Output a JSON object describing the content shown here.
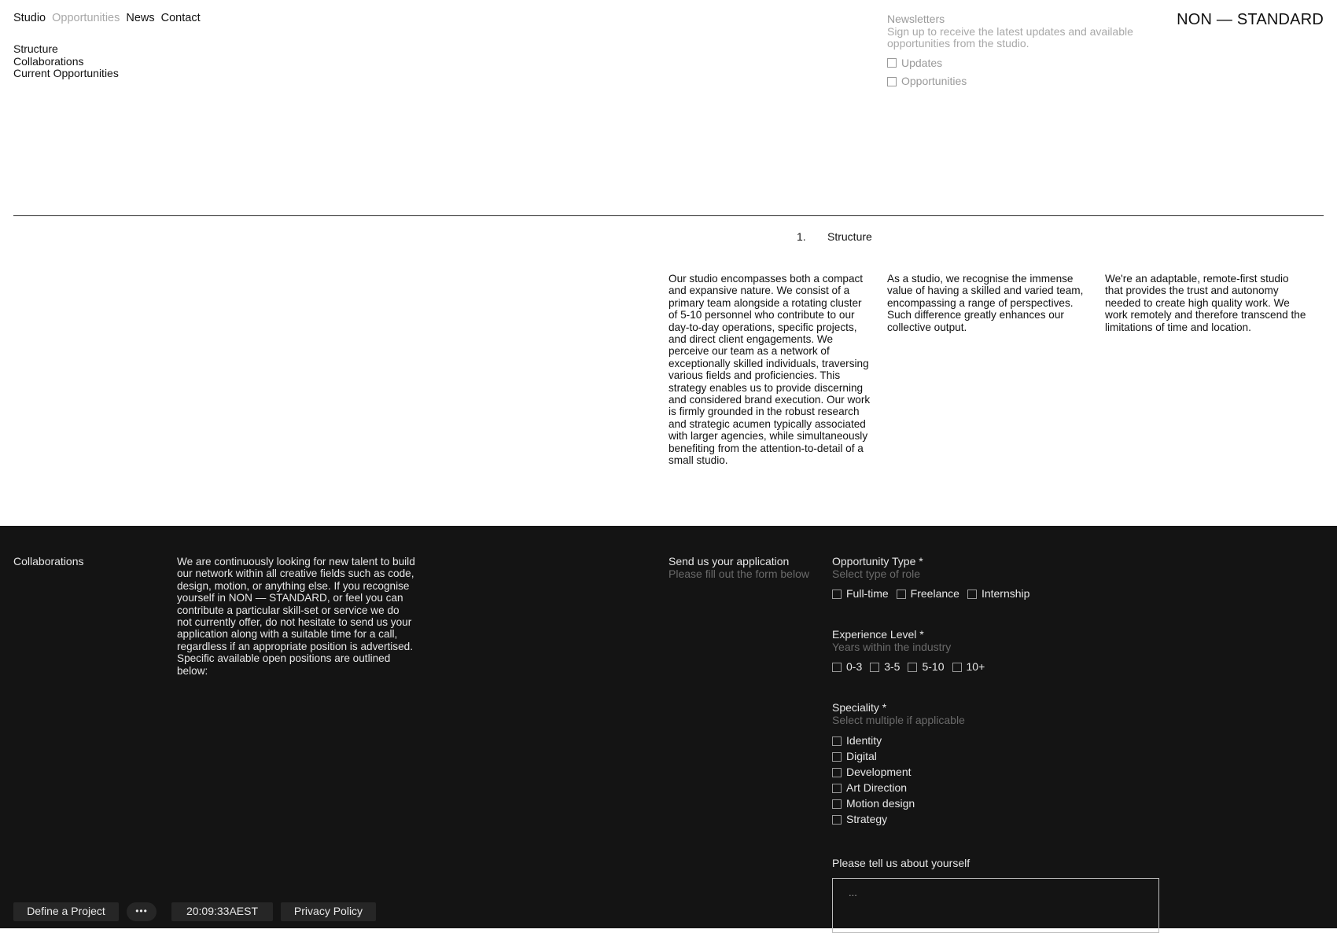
{
  "nav": {
    "items": [
      {
        "label": "Studio",
        "active": false
      },
      {
        "label": "Opportunities",
        "active": true
      },
      {
        "label": "News",
        "active": false
      },
      {
        "label": "Contact",
        "active": false
      }
    ],
    "sub_items": [
      "Structure",
      "Collaborations",
      "Current Opportunities"
    ]
  },
  "newsletter": {
    "title": "Newsletters",
    "description": "Sign up to receive the latest updates and available opportunities from the studio.",
    "options": [
      "Updates",
      "Opportunities"
    ]
  },
  "brand": "NON — STANDARD",
  "section": {
    "number": "1.",
    "title": "Structure",
    "columns": [
      "Our studio encompasses both a compact and expansive nature. We consist of a primary team alongside a rotating cluster of 5-10 personnel who contribute to our day-to-day operations, specific projects, and direct client engagements. We perceive our team as a network of exceptionally skilled individuals, traversing various fields and proficiencies. This strategy enables us to provide discerning and considered brand execution. Our work is firmly grounded in the robust research and strategic acumen typically associated with larger agencies, while simultaneously benefiting from the attention-to-detail of a small studio.",
      "As a studio, we recognise the immense value of having a skilled and varied team, encompassing a range of perspectives. Such difference greatly enhances our collective output.",
      "We're an adaptable, remote-first studio that provides the trust and autonomy needed to create high quality work. We work remotely and therefore transcend the limitations of time and location."
    ]
  },
  "collaborations": {
    "title": "Collaborations",
    "text": "We are continuously looking for new talent to build our network within all creative fields such as code, design, motion, or anything else. If you recognise yourself in NON — STANDARD, or feel you can contribute a particular skill-set or service we do not currently offer, do not hesitate to send us your application along with a suitable time for a call, regardless if an appropriate position is advertised. Specific available open positions are outlined below:"
  },
  "application": {
    "title": "Send us your application",
    "subtitle": "Please fill out the form below"
  },
  "form": {
    "opportunity": {
      "label": "Opportunity Type *",
      "hint": "Select type of role",
      "options": [
        "Full-time",
        "Freelance",
        "Internship"
      ]
    },
    "experience": {
      "label": "Experience Level *",
      "hint": "Years within the industry",
      "options": [
        "0-3",
        "3-5",
        "5-10",
        "10+"
      ]
    },
    "speciality": {
      "label": "Speciality *",
      "hint": "Select multiple if applicable",
      "options": [
        "Identity",
        "Digital",
        "Development",
        "Art Direction",
        "Motion design",
        "Strategy"
      ]
    },
    "about": {
      "label": "Please tell us about yourself",
      "placeholder": "..."
    }
  },
  "footer": {
    "define": "Define a Project",
    "more": "•••",
    "time": "20:09:33AEST",
    "privacy": "Privacy Policy"
  },
  "icons": {
    "checkbox": "checkbox-icon",
    "more": "ellipsis-icon"
  },
  "colors": {
    "background": "#ffffff",
    "dark_background": "#141414",
    "text": "#111111",
    "muted": "#a3a3a3"
  }
}
